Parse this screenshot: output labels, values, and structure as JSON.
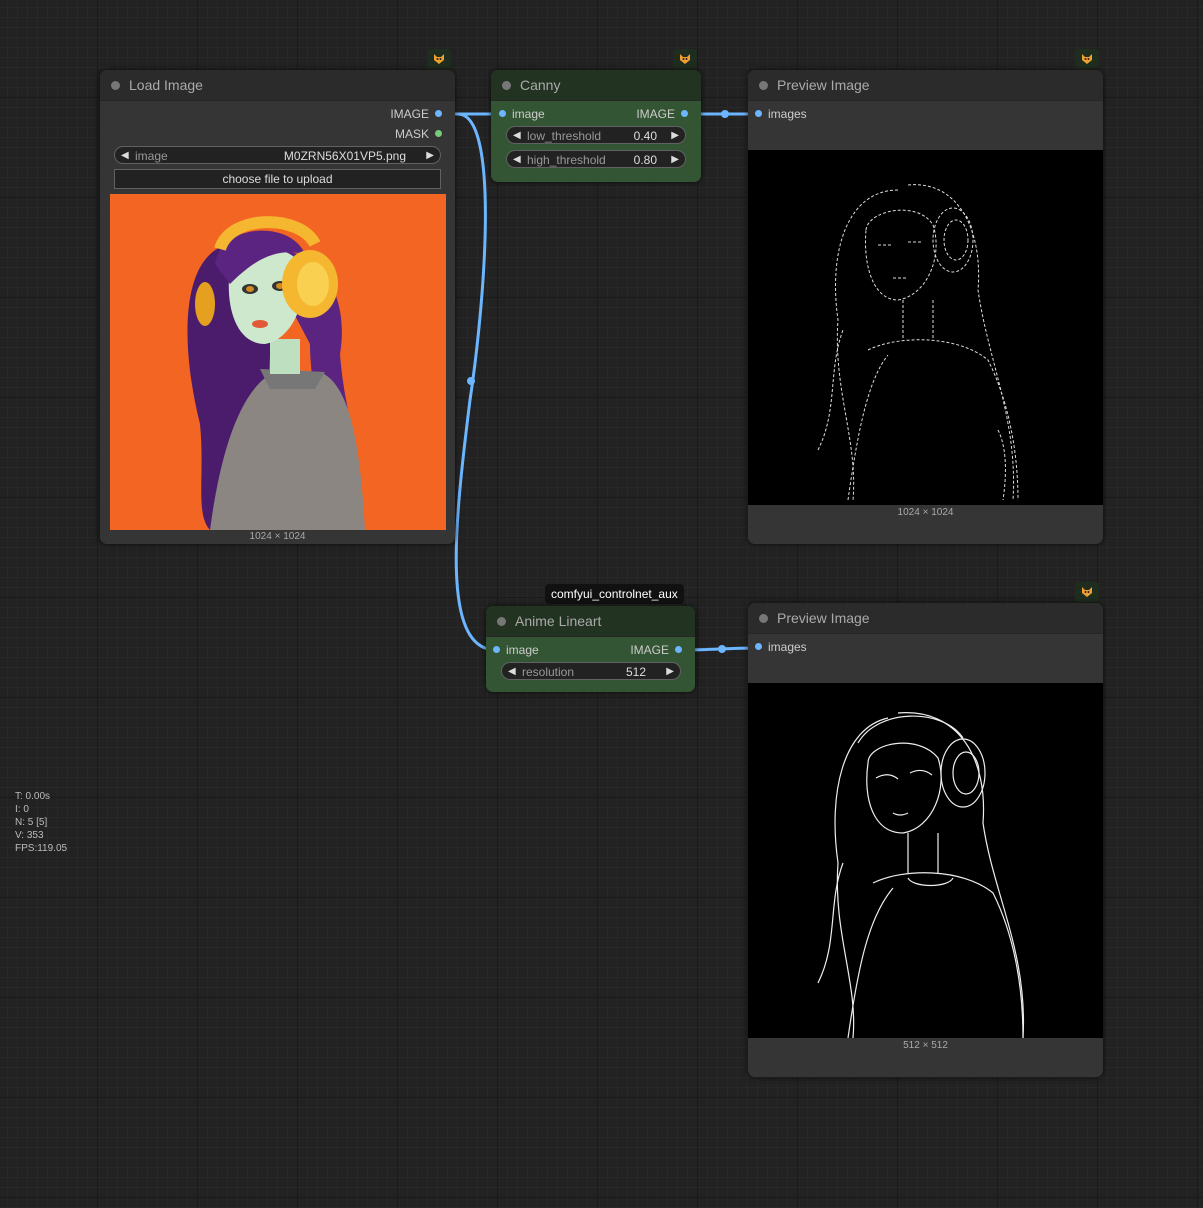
{
  "load_image": {
    "title": "Load Image",
    "outputs": [
      "IMAGE",
      "MASK"
    ],
    "image_widget_label": "image",
    "image_widget_value": "M0ZRN56X01VP5.png",
    "upload_label": "choose file to upload",
    "dims": "1024 × 1024"
  },
  "canny": {
    "title": "Canny",
    "input": "image",
    "output": "IMAGE",
    "low_label": "low_threshold",
    "low_value": "0.40",
    "high_label": "high_threshold",
    "high_value": "0.80"
  },
  "preview1": {
    "title": "Preview Image",
    "input": "images",
    "dims": "1024 × 1024"
  },
  "lineart": {
    "tag": "comfyui_controlnet_aux",
    "title": "Anime Lineart",
    "input": "image",
    "output": "IMAGE",
    "res_label": "resolution",
    "res_value": "512"
  },
  "preview2": {
    "title": "Preview Image",
    "input": "images",
    "dims": "512 × 512"
  },
  "stats": {
    "t": "T: 0.00s",
    "i": "I: 0",
    "n": "N: 5 [5]",
    "v": "V: 353",
    "fps": "FPS:119.05"
  },
  "colors": {
    "wire": "#6cb6ff",
    "node_green": "#335533",
    "node_dark": "#353535",
    "image_bg": "#f26522"
  },
  "icons": [
    "fox-badge-icon"
  ]
}
